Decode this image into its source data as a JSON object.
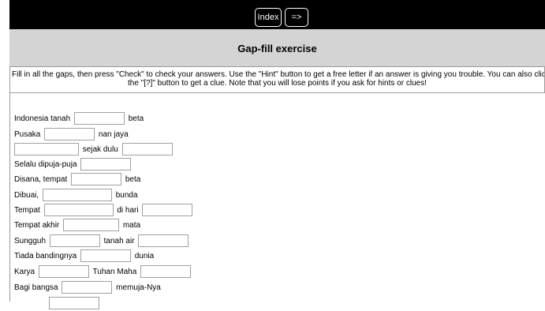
{
  "nav": {
    "index_label": "Index",
    "next_label": "=>"
  },
  "title": "Gap-fill exercise",
  "instructions": [
    "Fill in all the gaps, then press \"Check\" to check your answers. Use the \"Hint\" button to get a free letter if an answer is giving you trouble. You can also click on",
    "the \"[?]\" button to get a clue. Note that you will lose points if you ask for hints or clues!"
  ],
  "lines": [
    {
      "before": "Indonesia tanah",
      "middle": "beta",
      "after": ""
    },
    {
      "before": "Pusaka",
      "middle": "nan jaya",
      "after": ""
    },
    {
      "before": "",
      "middle": "sejak dulu",
      "after": ""
    },
    {
      "before": "Selalu dipuja-puja",
      "middle": "",
      "after": ""
    },
    {
      "before": "Disana, tempat",
      "middle": "beta",
      "after": ""
    },
    {
      "before": "Dibuai,",
      "middle": "bunda",
      "after": ""
    },
    {
      "before": "Tempat",
      "middle": "di hari",
      "after": ""
    },
    {
      "before": "Tempat akhir",
      "middle": "mata",
      "after": ""
    },
    {
      "before": "Sungguh",
      "middle": "tanah air",
      "after": ""
    },
    {
      "before": "Tiada bandingnya",
      "middle": "dunia",
      "after": ""
    },
    {
      "before": "Karya",
      "middle": "Tuhan Maha",
      "after": ""
    },
    {
      "before": "Bagi bangsa",
      "middle": "memuja-Nya",
      "after": ""
    }
  ]
}
